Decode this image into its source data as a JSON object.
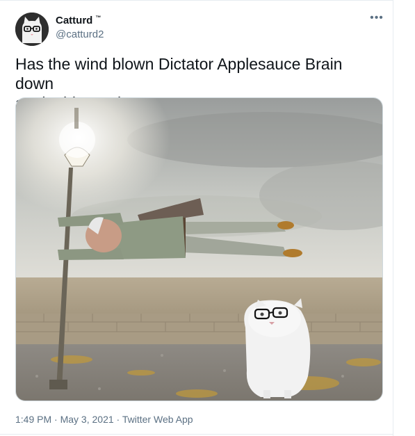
{
  "author": {
    "display_name": "Catturd",
    "trademark": "™",
    "handle": "@catturd2",
    "avatar_icon": "cat-with-glasses-avatar-icon"
  },
  "more_icon": "more-options-icon",
  "tweet": {
    "text_line1": "Has the wind blown Dictator Applesauce Brain down",
    "text_line2": "again this week yet?"
  },
  "media": {
    "image_icon": "meme-photo-man-blown-sideways-from-lamppost-with-cat"
  },
  "meta": {
    "time": "1:49 PM",
    "sep1": " · ",
    "date": "May 3, 2021",
    "sep2": " · ",
    "source": "Twitter Web App"
  },
  "colors": {
    "text_primary": "#0f1419",
    "text_secondary": "#5b7083",
    "border": "#cfd9de"
  }
}
